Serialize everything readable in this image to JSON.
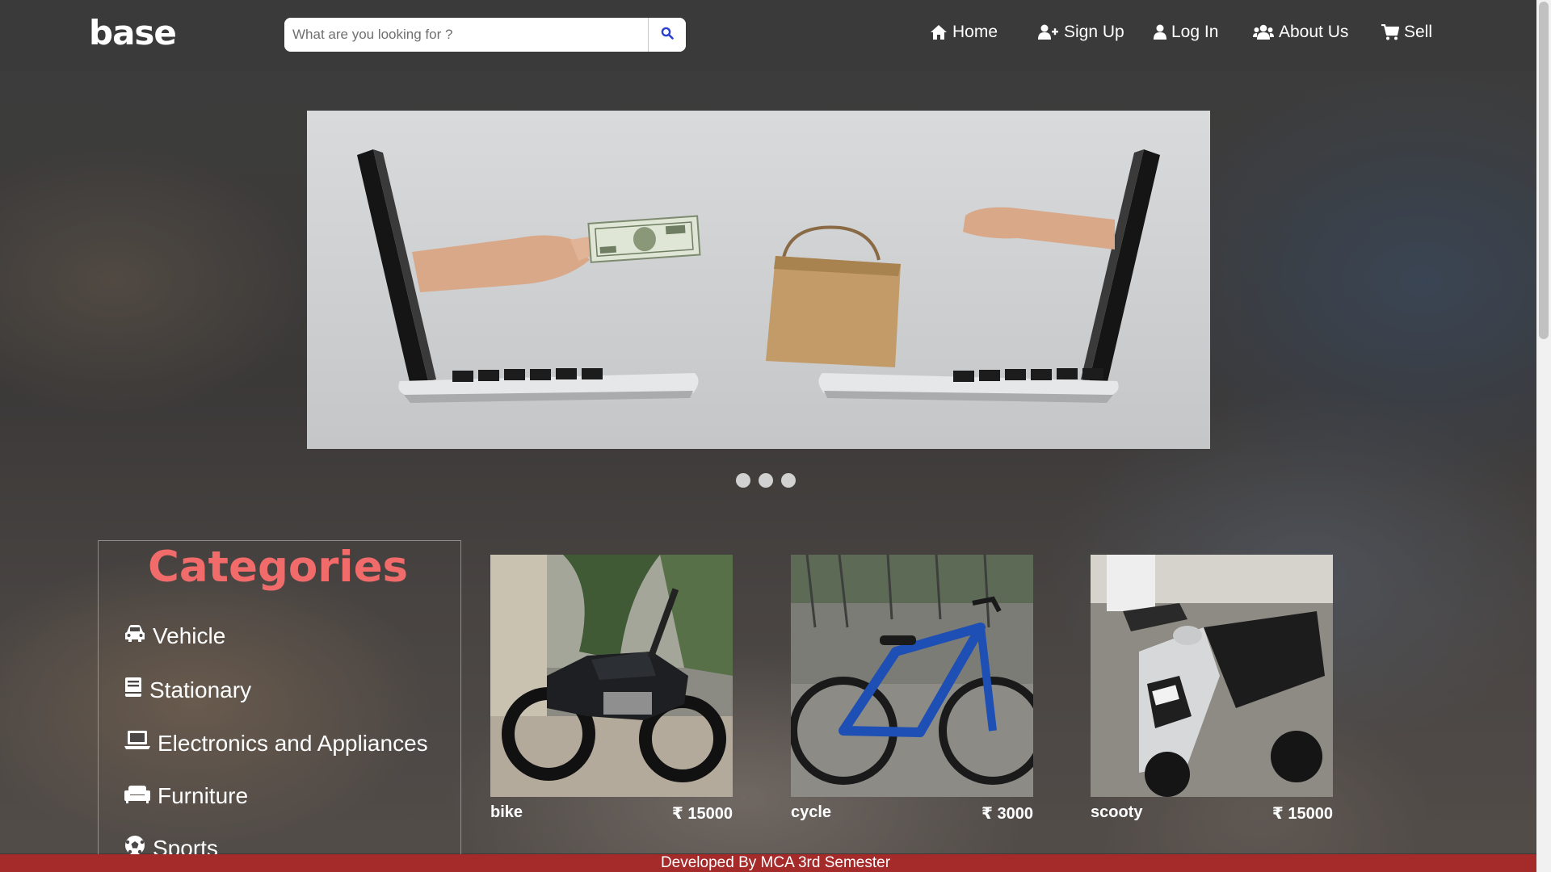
{
  "brand": {
    "logo_text": "base"
  },
  "search": {
    "placeholder": "What are you looking for ?",
    "icon": "search-icon"
  },
  "nav": {
    "items": [
      {
        "label": "Home",
        "icon": "home-icon"
      },
      {
        "label": "Sign Up",
        "icon": "user-plus-icon"
      },
      {
        "label": "Log In",
        "icon": "user-icon"
      },
      {
        "label": "About Us",
        "icon": "users-icon"
      },
      {
        "label": "Sell",
        "icon": "shopping-cart-icon"
      }
    ]
  },
  "carousel": {
    "slide_count": 3,
    "active_index": 0
  },
  "categories": {
    "title": "Categories",
    "items": [
      {
        "label": "Vehicle",
        "icon": "car-icon"
      },
      {
        "label": "Stationary",
        "icon": "book-icon"
      },
      {
        "label": "Electronics and Appliances",
        "icon": "laptop-icon"
      },
      {
        "label": "Furniture",
        "icon": "couch-icon"
      },
      {
        "label": "Sports",
        "icon": "soccer-ball-icon"
      }
    ]
  },
  "products": [
    {
      "name": "bike",
      "price": "₹ 15000"
    },
    {
      "name": "cycle",
      "price": "₹ 3000"
    },
    {
      "name": "scooty",
      "price": "₹ 15000"
    }
  ],
  "footer": {
    "text": "Developed By MCA 3rd Semester"
  },
  "colors": {
    "navbar": "#3a3a3a",
    "category_title": "#f26b6b",
    "footer": "#a52a2a",
    "search_icon": "#2b3fd1"
  }
}
